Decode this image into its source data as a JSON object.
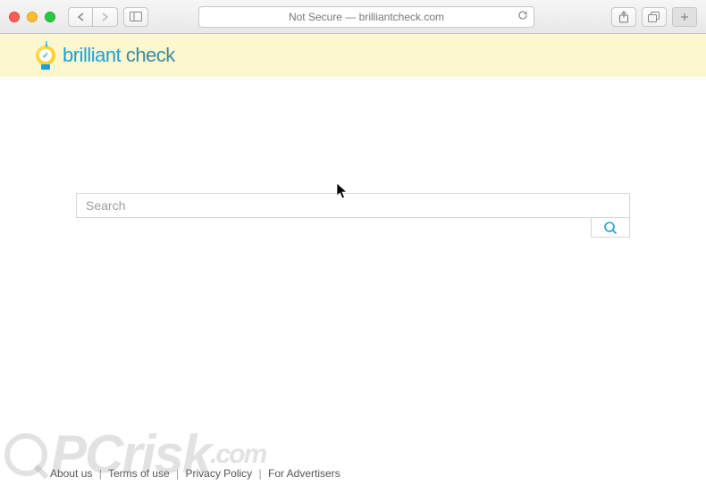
{
  "toolbar": {
    "address_text": "Not Secure — brilliantcheck.com"
  },
  "brand": {
    "word1": "brilliant ",
    "word2": "check"
  },
  "search": {
    "placeholder": "Search",
    "value": ""
  },
  "footer": {
    "about": "About us",
    "terms": "Terms of use",
    "privacy": "Privacy Policy",
    "advertisers": "For Advertisers",
    "sep": "|"
  },
  "watermark": {
    "text": "PCrisk",
    "suffix": ".com"
  }
}
